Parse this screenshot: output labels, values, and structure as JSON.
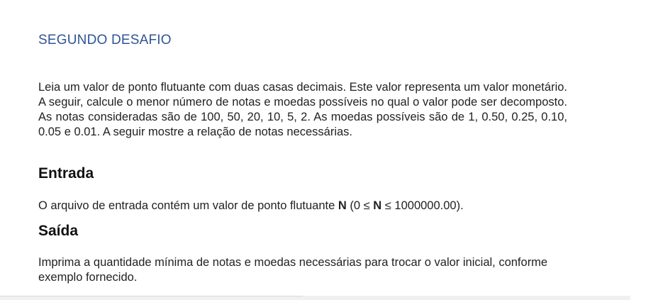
{
  "section_title": "SEGUNDO DESAFIO",
  "intro": "Leia um valor de ponto flutuante com duas casas decimais. Este valor representa um valor monetário. A seguir, calcule o menor número de notas e moedas possíveis no qual o valor pode ser decomposto. As notas consideradas são de 100, 50, 20, 10, 5, 2. As moedas possíveis são de 1, 0.50, 0.25, 0.10, 0.05 e 0.01. A seguir mostre a relação de notas necessárias.",
  "entrada": {
    "heading": "Entrada",
    "text_before": "O arquivo de entrada contém um valor de ponto flutuante ",
    "var_n": "N",
    "text_middle": " (0 ≤ ",
    "var_n2": "N",
    "text_after": " ≤ 1000000.00)."
  },
  "saida": {
    "heading": "Saída",
    "text": "Imprima a quantidade mínima de notas e moedas necessárias para trocar o valor inicial, conforme exemplo fornecido."
  }
}
